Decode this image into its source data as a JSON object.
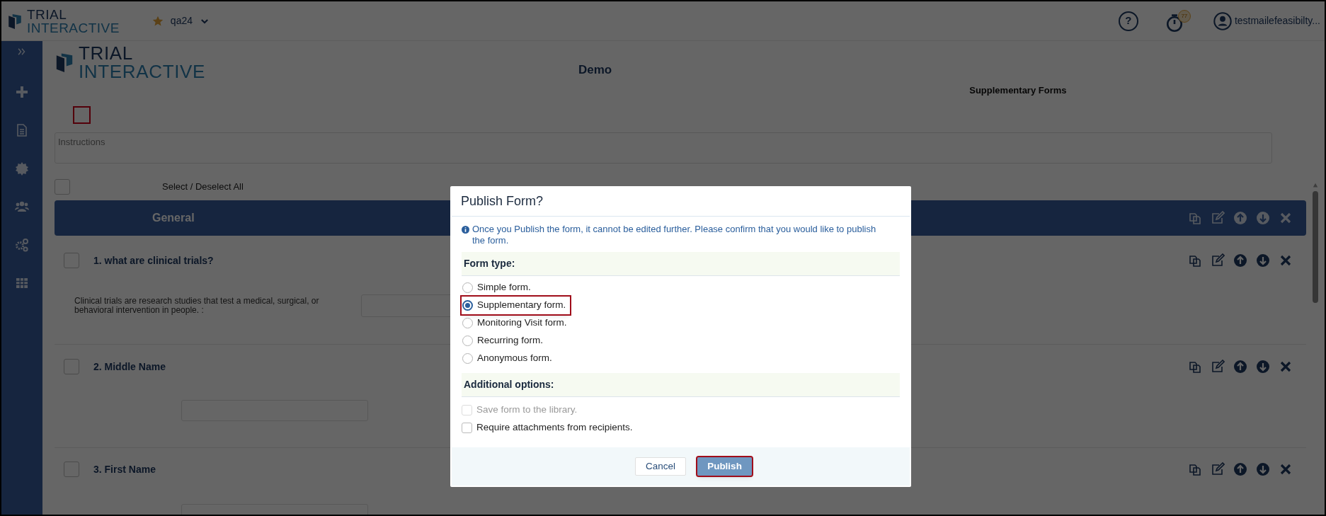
{
  "header": {
    "logo": {
      "line1": "TRIAL",
      "line2": "INTERACTIVE"
    },
    "study": "qa24",
    "help": "?",
    "timer_badge": "77",
    "user": "testmailefeasibilty..."
  },
  "form": {
    "logo": {
      "line1": "TRIAL",
      "line2": "INTERACTIVE"
    },
    "title": "Demo",
    "subtitle": "Supplementary Forms",
    "instructions": {
      "placeholder": "Instructions"
    },
    "select_all": {
      "label": "Select / Deselect All",
      "checked": false
    },
    "section": {
      "title": "General"
    },
    "questions": [
      {
        "title": "1. what are clinical trials?",
        "checked": false,
        "kind": "prompt",
        "prompt": "Clinical trials are research studies that test a medical, surgical, or behavioral intervention in people. :"
      },
      {
        "title": "2. Middle Name",
        "checked": false,
        "kind": "field"
      },
      {
        "title": "3. First Name",
        "checked": false,
        "kind": "field"
      }
    ]
  },
  "dialog": {
    "title": "Publish Form?",
    "info": "Once you Publish the form, it cannot be edited further. Please confirm that you would like to publish the form.",
    "form_type_heading": "Form type:",
    "form_types": [
      {
        "label": "Simple form.",
        "selected": false,
        "highlighted": false
      },
      {
        "label": "Supplementary form.",
        "selected": true,
        "highlighted": true
      },
      {
        "label": "Monitoring Visit form.",
        "selected": false,
        "highlighted": false
      },
      {
        "label": "Recurring form.",
        "selected": false,
        "highlighted": false
      },
      {
        "label": "Anonymous form.",
        "selected": false,
        "highlighted": false
      }
    ],
    "additional_heading": "Additional options:",
    "options": [
      {
        "label": "Save form to the library.",
        "checked": false,
        "disabled": true
      },
      {
        "label": "Require attachments from recipients.",
        "checked": false,
        "disabled": false
      }
    ],
    "buttons": [
      {
        "label": "Cancel",
        "kind": "secondary",
        "highlighted": false
      },
      {
        "label": "Publish",
        "kind": "primary",
        "highlighted": true
      }
    ]
  }
}
